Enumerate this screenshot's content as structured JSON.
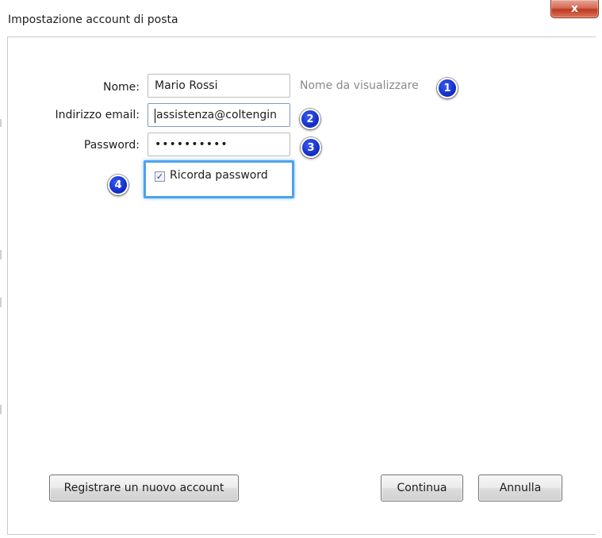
{
  "window": {
    "title": "Impostazione account di posta",
    "close_label": "x"
  },
  "form": {
    "name_label": "Nome:",
    "name_value": "Mario Rossi",
    "name_hint": "Nome da visualizzare",
    "email_label": "Indirizzo email:",
    "email_value": "assistenza@coltengin",
    "password_label": "Password:",
    "password_value": "••••••••••",
    "remember_label": "Ricorda password",
    "remember_checked": true,
    "remember_mark": "✓"
  },
  "badges": [
    "1",
    "2",
    "3",
    "4"
  ],
  "buttons": {
    "register": "Registrare un nuovo account",
    "continue": "Continua",
    "cancel": "Annulla"
  },
  "colors": {
    "badge": "#1530c8",
    "highlight": "#4aa3ef",
    "close": "#c0381f"
  }
}
